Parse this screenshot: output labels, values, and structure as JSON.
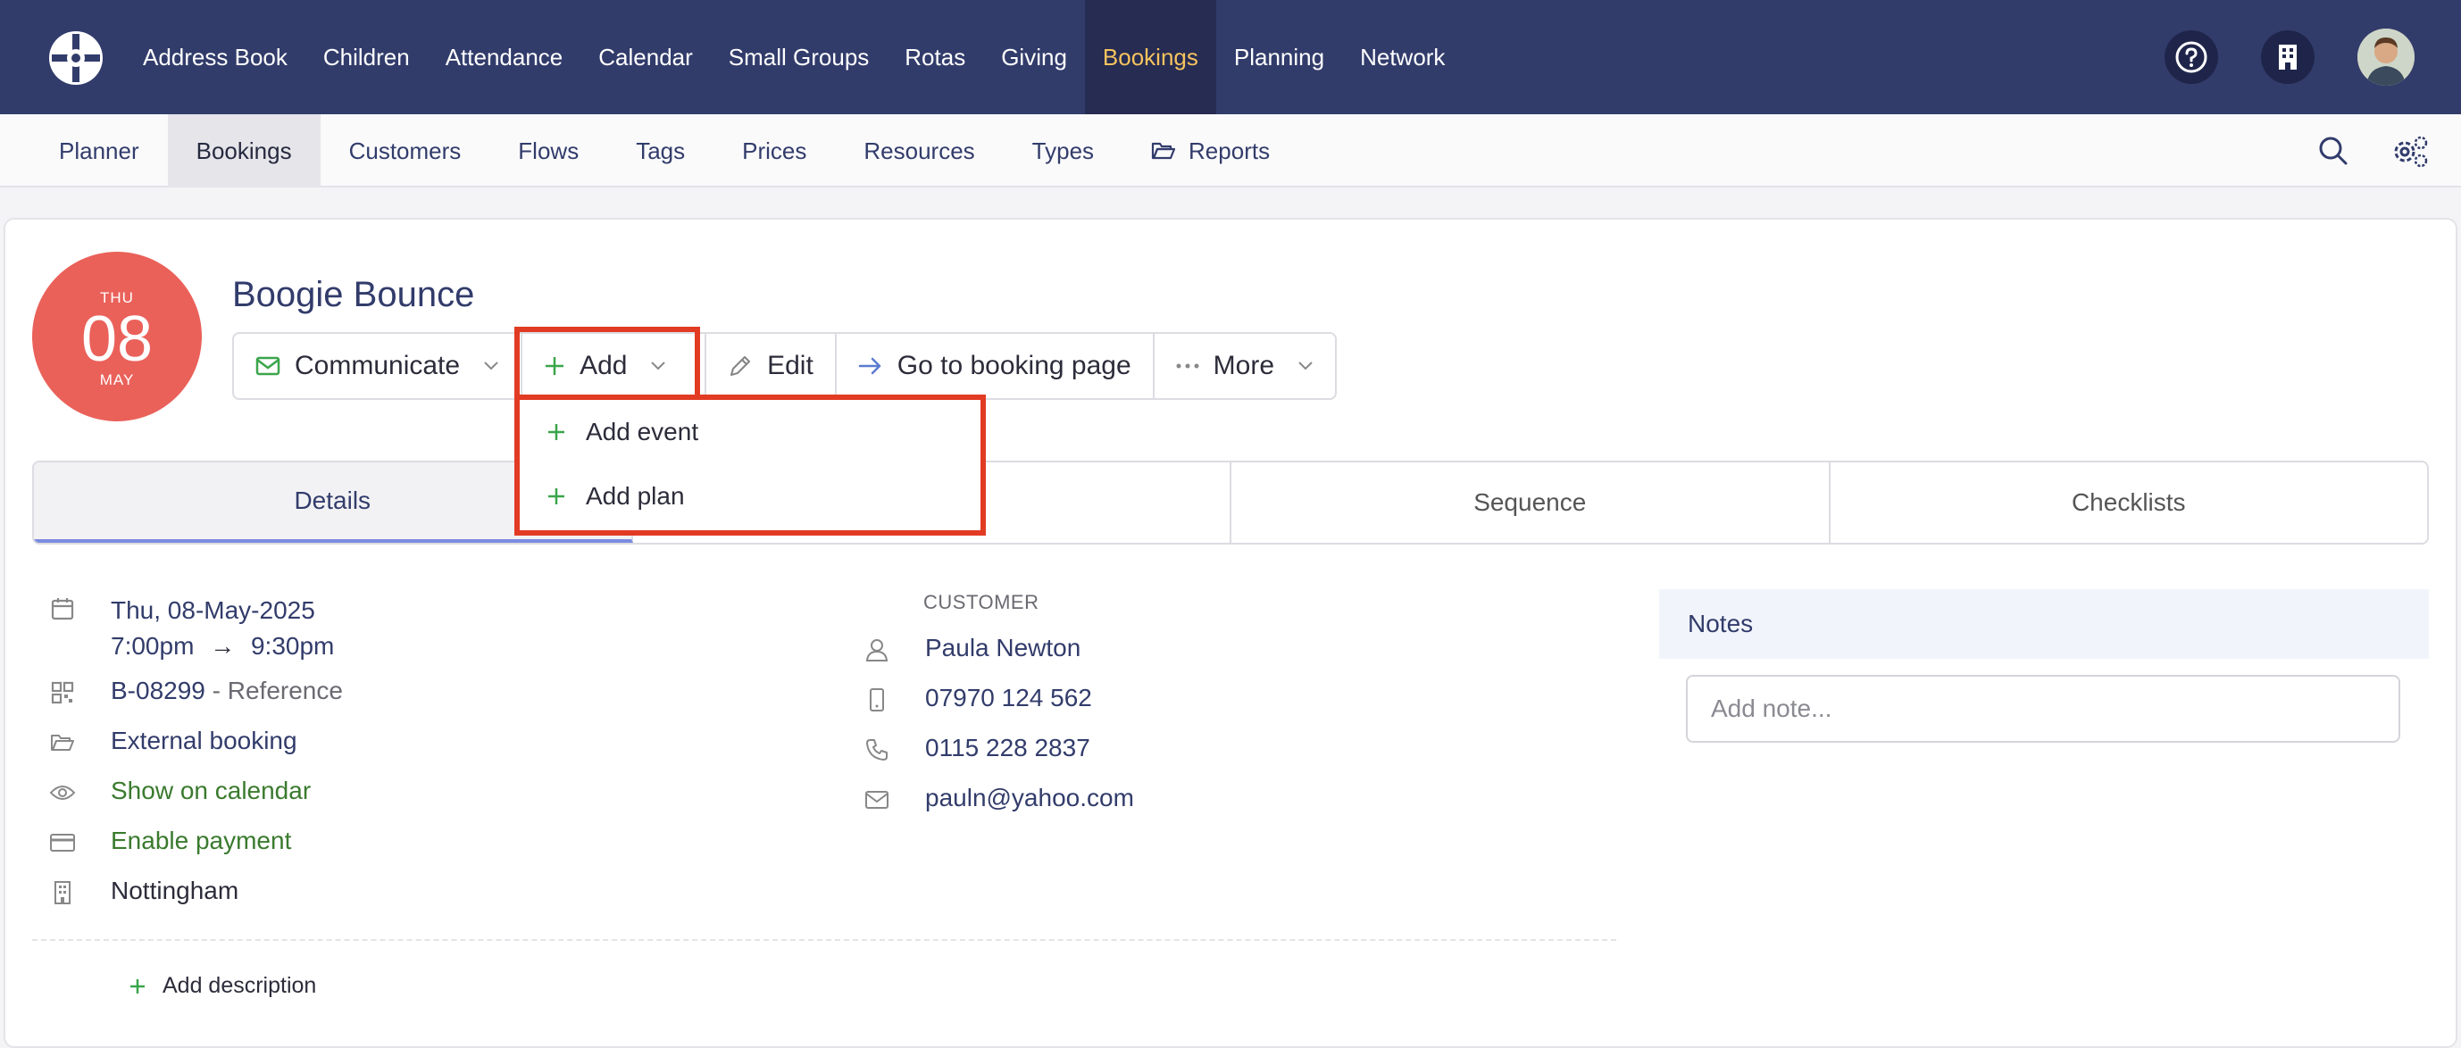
{
  "topnav": {
    "items": [
      "Address Book",
      "Children",
      "Attendance",
      "Calendar",
      "Small Groups",
      "Rotas",
      "Giving",
      "Bookings",
      "Planning",
      "Network"
    ],
    "active": "Bookings"
  },
  "subnav": {
    "items": [
      "Planner",
      "Bookings",
      "Customers",
      "Flows",
      "Tags",
      "Prices",
      "Resources",
      "Types",
      "Reports"
    ],
    "active": "Bookings"
  },
  "booking": {
    "date": {
      "dow": "THU",
      "day": "08",
      "month": "MAY"
    },
    "title": "Boogie Bounce"
  },
  "actions": {
    "communicate": "Communicate",
    "add": "Add",
    "edit": "Edit",
    "goto": "Go to booking page",
    "more": "More"
  },
  "add_menu": {
    "items": [
      "Add event",
      "Add plan"
    ]
  },
  "tabs": [
    "Details",
    "",
    "Sequence",
    "Checklists"
  ],
  "details": {
    "date_line": "Thu, 08-May-2025",
    "start": "7:00pm",
    "arrow": "→",
    "end": "9:30pm",
    "reference_code": "B-08299",
    "reference_suffix": " - Reference",
    "type": "External booking",
    "visibility": "Show on calendar",
    "payment": "Enable payment",
    "location": "Nottingham",
    "add_description": "Add description"
  },
  "customer": {
    "heading": "CUSTOMER",
    "name": "Paula Newton",
    "mobile": "07970 124 562",
    "phone": "0115 228 2837",
    "email": "pauln@yahoo.com"
  },
  "notes": {
    "heading": "Notes",
    "placeholder": "Add note..."
  },
  "colors": {
    "nav_bg": "#323c6b",
    "nav_active_text": "#f7c35f",
    "date_badge": "#ea615a",
    "highlight": "#e23b24",
    "green_text": "#3a7a2e"
  }
}
